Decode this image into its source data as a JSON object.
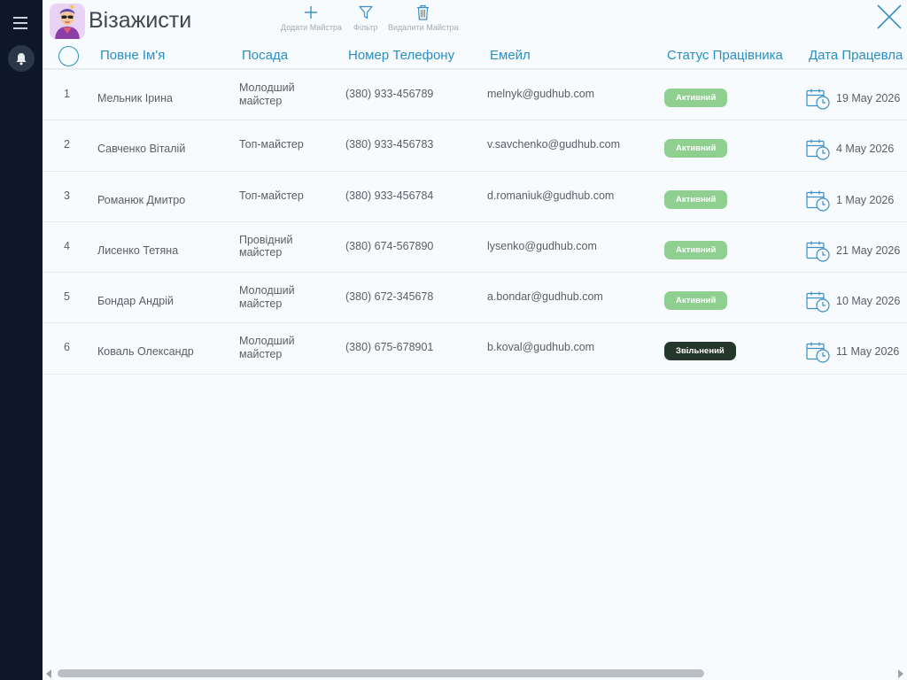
{
  "sidebar": {
    "menu_icon": "hamburger-icon",
    "bell_icon": "bell-icon"
  },
  "app": {
    "title": "Візажисти",
    "icon": "makeup-artist-avatar-icon"
  },
  "toolbar": {
    "add_label": "Додати Майстра",
    "filter_label": "Фільтр",
    "delete_label": "Видалити Майстра"
  },
  "table": {
    "columns": {
      "name": "Повне Ім'я",
      "position": "Посада",
      "phone": "Номер Телефону",
      "email": "Емейл",
      "status": "Статус Працівника",
      "date": "Дата Працевла"
    },
    "rows": [
      {
        "num": "1",
        "name": "Мельник Ірина",
        "position": "Молодший майстер",
        "phone": "(380) 933-456789",
        "email": "melnyk@gudhub.com",
        "status": "Активний",
        "status_color": "#8fcf8f",
        "date": "19 May 2026"
      },
      {
        "num": "2",
        "name": "Савченко Віталій",
        "position": "Топ-майстер",
        "phone": "(380) 933-456783",
        "email": "v.savchenko@gudhub.com",
        "status": "Активний",
        "status_color": "#8fcf8f",
        "date": "4 May 2026"
      },
      {
        "num": "3",
        "name": "Романюк Дмитро",
        "position": "Топ-майстер",
        "phone": "(380) 933-456784",
        "email": "d.romaniuk@gudhub.com",
        "status": "Активний",
        "status_color": "#8fcf8f",
        "date": "1 May 2026"
      },
      {
        "num": "4",
        "name": "Лисенко Тетяна",
        "position": "Провідний майстер",
        "phone": "(380) 674-567890",
        "email": "lysenko@gudhub.com",
        "status": "Активний",
        "status_color": "#8fcf8f",
        "date": "21 May 2026"
      },
      {
        "num": "5",
        "name": "Бондар Андрій",
        "position": "Молодший майстер",
        "phone": "(380) 672-345678",
        "email": "a.bondar@gudhub.com",
        "status": "Активний",
        "status_color": "#8fcf8f",
        "date": "10 May 2026"
      },
      {
        "num": "6",
        "name": "Коваль Олександр",
        "position": "Молодший майстер",
        "phone": "(380) 675-678901",
        "email": "b.koval@gudhub.com",
        "status": "Звільнений",
        "status_color": "#25362a",
        "date": "11 May 2026"
      }
    ]
  },
  "colors": {
    "accent": "#2a8fc5",
    "sidebar_bg": "#0d1727",
    "active": "#8fcf8f",
    "dismissed": "#25362a"
  }
}
